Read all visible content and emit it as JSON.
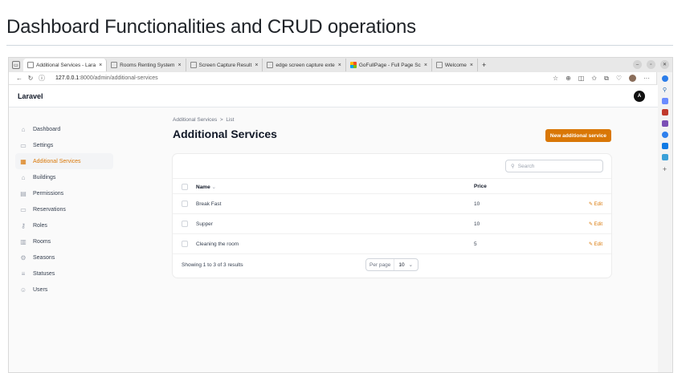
{
  "heading": "Dashboard Functionalities and CRUD operations",
  "browser": {
    "tabs": [
      {
        "label": "Additional Services - Lara",
        "active": true
      },
      {
        "label": "Rooms Renting System",
        "active": false
      },
      {
        "label": "Screen Capture Result",
        "active": false
      },
      {
        "label": "edge screen capture exte",
        "active": false
      },
      {
        "label": "GoFullPage - Full Page Sc",
        "active": false
      },
      {
        "label": "Welcome",
        "active": false
      }
    ],
    "url_host": "127.0.0.1",
    "url_path": ":8000/admin/additional-services"
  },
  "app": {
    "brand": "Laravel",
    "user_initial": "A",
    "sidebar": [
      {
        "label": "Dashboard",
        "icon": "home-icon",
        "glyph": "⌂",
        "active": false
      },
      {
        "label": "Settings",
        "icon": "document-icon",
        "glyph": "▭",
        "active": false
      },
      {
        "label": "Additional Services",
        "icon": "grid-icon",
        "glyph": "▦",
        "active": true
      },
      {
        "label": "Buildings",
        "icon": "home-icon",
        "glyph": "⌂",
        "active": false
      },
      {
        "label": "Permissions",
        "icon": "calendar-icon",
        "glyph": "▤",
        "active": false
      },
      {
        "label": "Reservations",
        "icon": "receipt-icon",
        "glyph": "▭",
        "active": false
      },
      {
        "label": "Roles",
        "icon": "key-icon",
        "glyph": "⚷",
        "active": false
      },
      {
        "label": "Rooms",
        "icon": "building-icon",
        "glyph": "▥",
        "active": false
      },
      {
        "label": "Seasons",
        "icon": "gear-icon",
        "glyph": "⚙",
        "active": false
      },
      {
        "label": "Statuses",
        "icon": "list-icon",
        "glyph": "≡",
        "active": false
      },
      {
        "label": "Users",
        "icon": "users-icon",
        "glyph": "☺",
        "active": false
      }
    ],
    "breadcrumb": {
      "parent": "Additional Services",
      "sep": ">",
      "current": "List"
    },
    "title": "Additional Services",
    "new_button": "New additional service",
    "search_placeholder": "Search",
    "columns": {
      "name": "Name",
      "name_sort": "⌄",
      "price": "Price"
    },
    "rows": [
      {
        "name": "Break Fast",
        "price": "10"
      },
      {
        "name": "Supper",
        "price": "10"
      },
      {
        "name": "Cleaning the room",
        "price": "5"
      }
    ],
    "edit_label": "Edit",
    "edit_glyph": "✎",
    "showing": "Showing 1 to 3 of 3 results",
    "per_page_label": "Per page",
    "per_page_value": "10",
    "per_page_chevron": "⌄"
  },
  "colors": {
    "accent": "#d97706",
    "active_bg": "#f3f4f6"
  }
}
